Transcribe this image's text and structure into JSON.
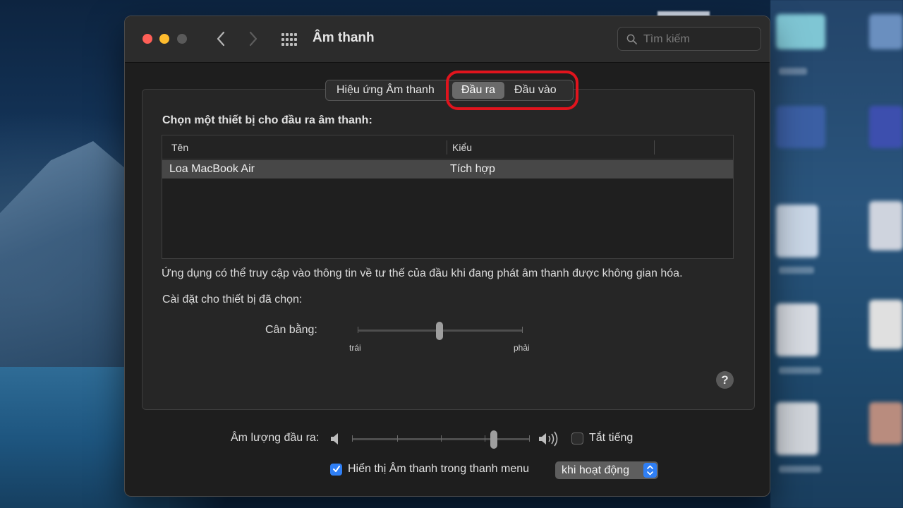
{
  "window": {
    "title": "Âm thanh",
    "search_placeholder": "Tìm kiếm"
  },
  "tabs": [
    {
      "label": "Hiệu ứng Âm thanh",
      "active": false
    },
    {
      "label": "Đầu ra",
      "active": true
    },
    {
      "label": "Đầu vào",
      "active": false
    }
  ],
  "output": {
    "section_title": "Chọn một thiết bị cho đầu ra âm thanh:",
    "columns": [
      "Tên",
      "Kiểu"
    ],
    "rows": [
      {
        "name": "Loa MacBook Air",
        "type": "Tích hợp"
      }
    ],
    "note": "Ứng dụng có thể truy cập vào thông tin về tư thế của đầu khi đang phát âm thanh được không gian hóa.",
    "settings_label": "Cài đặt cho thiết bị đã chọn:",
    "balance": {
      "label": "Cân bằng:",
      "left_label": "trái",
      "right_label": "phải",
      "value": 0.5
    },
    "help": "?"
  },
  "volume": {
    "label": "Âm lượng đầu ra:",
    "value": 0.81,
    "mute_label": "Tắt tiếng",
    "muted": false
  },
  "menubar": {
    "label": "Hiển thị Âm thanh trong thanh menu",
    "checked": true,
    "option": "khi hoạt động"
  },
  "colors": {
    "accent": "#2f7ff5",
    "highlight_ring": "#e0141d"
  }
}
